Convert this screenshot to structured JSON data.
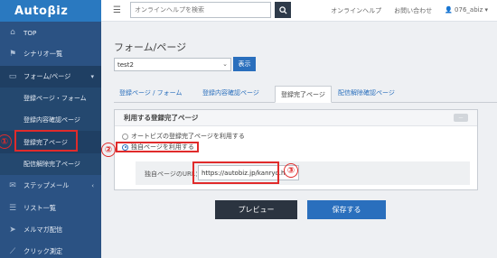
{
  "app": {
    "logo": "Autoβiz"
  },
  "sidebar": {
    "items": [
      {
        "icon": "home-icon",
        "label": "TOP"
      },
      {
        "icon": "flag-icon",
        "label": "シナリオ一覧"
      },
      {
        "icon": "page-icon",
        "label": "フォーム/ページ",
        "caret": "▾"
      },
      {
        "label": "登録ページ・フォーム"
      },
      {
        "label": "登録内容確認ページ"
      },
      {
        "label": "登録完了ページ"
      },
      {
        "label": "配信解除完了ページ"
      },
      {
        "icon": "mail-icon",
        "label": "ステップメール",
        "caret": "‹"
      },
      {
        "icon": "list-icon",
        "label": "リスト一覧"
      },
      {
        "icon": "send-icon",
        "label": "メルマガ配信"
      },
      {
        "icon": "chart-icon",
        "label": "クリック測定"
      }
    ]
  },
  "topbar": {
    "search_placeholder": "オンラインヘルプを検索",
    "help_link": "オンラインヘルプ",
    "contact_link": "お問い合わせ",
    "user": "076_abiz ▾"
  },
  "main": {
    "page_title": "フォーム/ページ",
    "select_value": "test2",
    "show_button": "表示",
    "tabs": [
      {
        "label": "登録ページ / フォーム"
      },
      {
        "label": "登録内容確認ページ"
      },
      {
        "label": "登録完了ページ"
      },
      {
        "label": "配信解除確認ページ"
      }
    ],
    "panel": {
      "title": "利用する登録完了ページ",
      "option_default": "オートビズの登録完了ページを利用する",
      "option_custom": "独自ページを利用する",
      "url_label": "独自ページのURL：",
      "url_value": "https://autobiz.jp/kanryo.h"
    },
    "preview_button": "プレビュー",
    "save_button": "保存する"
  },
  "annotations": {
    "n1": "①",
    "n2": "②",
    "n3": "③"
  },
  "colors": {
    "sidebar": "#2b5283",
    "accent": "#2a6fbd",
    "annotation": "#e02b2b"
  }
}
